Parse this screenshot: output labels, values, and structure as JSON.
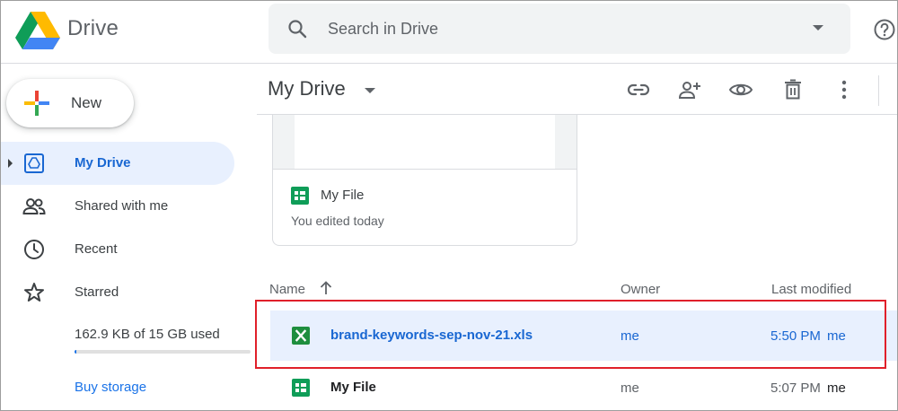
{
  "header": {
    "app_name": "Drive",
    "search_placeholder": "Search in Drive"
  },
  "sidebar": {
    "new_label": "New",
    "items": [
      {
        "label": "My Drive",
        "active": true,
        "icon": "my-drive-icon"
      },
      {
        "label": "Shared with me",
        "active": false,
        "icon": "people-icon"
      },
      {
        "label": "Recent",
        "active": false,
        "icon": "clock-icon"
      },
      {
        "label": "Starred",
        "active": false,
        "icon": "star-icon"
      }
    ],
    "storage_text": "162.9 KB of 15 GB used",
    "storage_fraction": 0.01,
    "buy_storage": "Buy storage"
  },
  "main": {
    "title": "My Drive",
    "toolbar_icons": [
      "link-icon",
      "add-person-icon",
      "eye-icon",
      "trash-icon",
      "more-vert-icon"
    ],
    "card": {
      "title": "My File",
      "subtitle": "You edited today",
      "icon": "sheets-icon"
    },
    "columns": {
      "name": "Name",
      "owner": "Owner",
      "modified": "Last modified"
    },
    "rows": [
      {
        "name": "brand-keywords-sep-nov-21.xls",
        "owner": "me",
        "time": "5:50 PM",
        "by": "me",
        "icon": "excel-icon",
        "selected": true
      },
      {
        "name": "My File",
        "owner": "me",
        "time": "5:07 PM",
        "by": "me",
        "icon": "sheets-icon",
        "selected": false
      }
    ]
  },
  "colors": {
    "accent": "#1a73e8",
    "selected_bg": "#e8f0fe",
    "highlight": "#e0202a",
    "sheets_green": "#0f9d58",
    "excel_green": "#1e8e3e"
  }
}
